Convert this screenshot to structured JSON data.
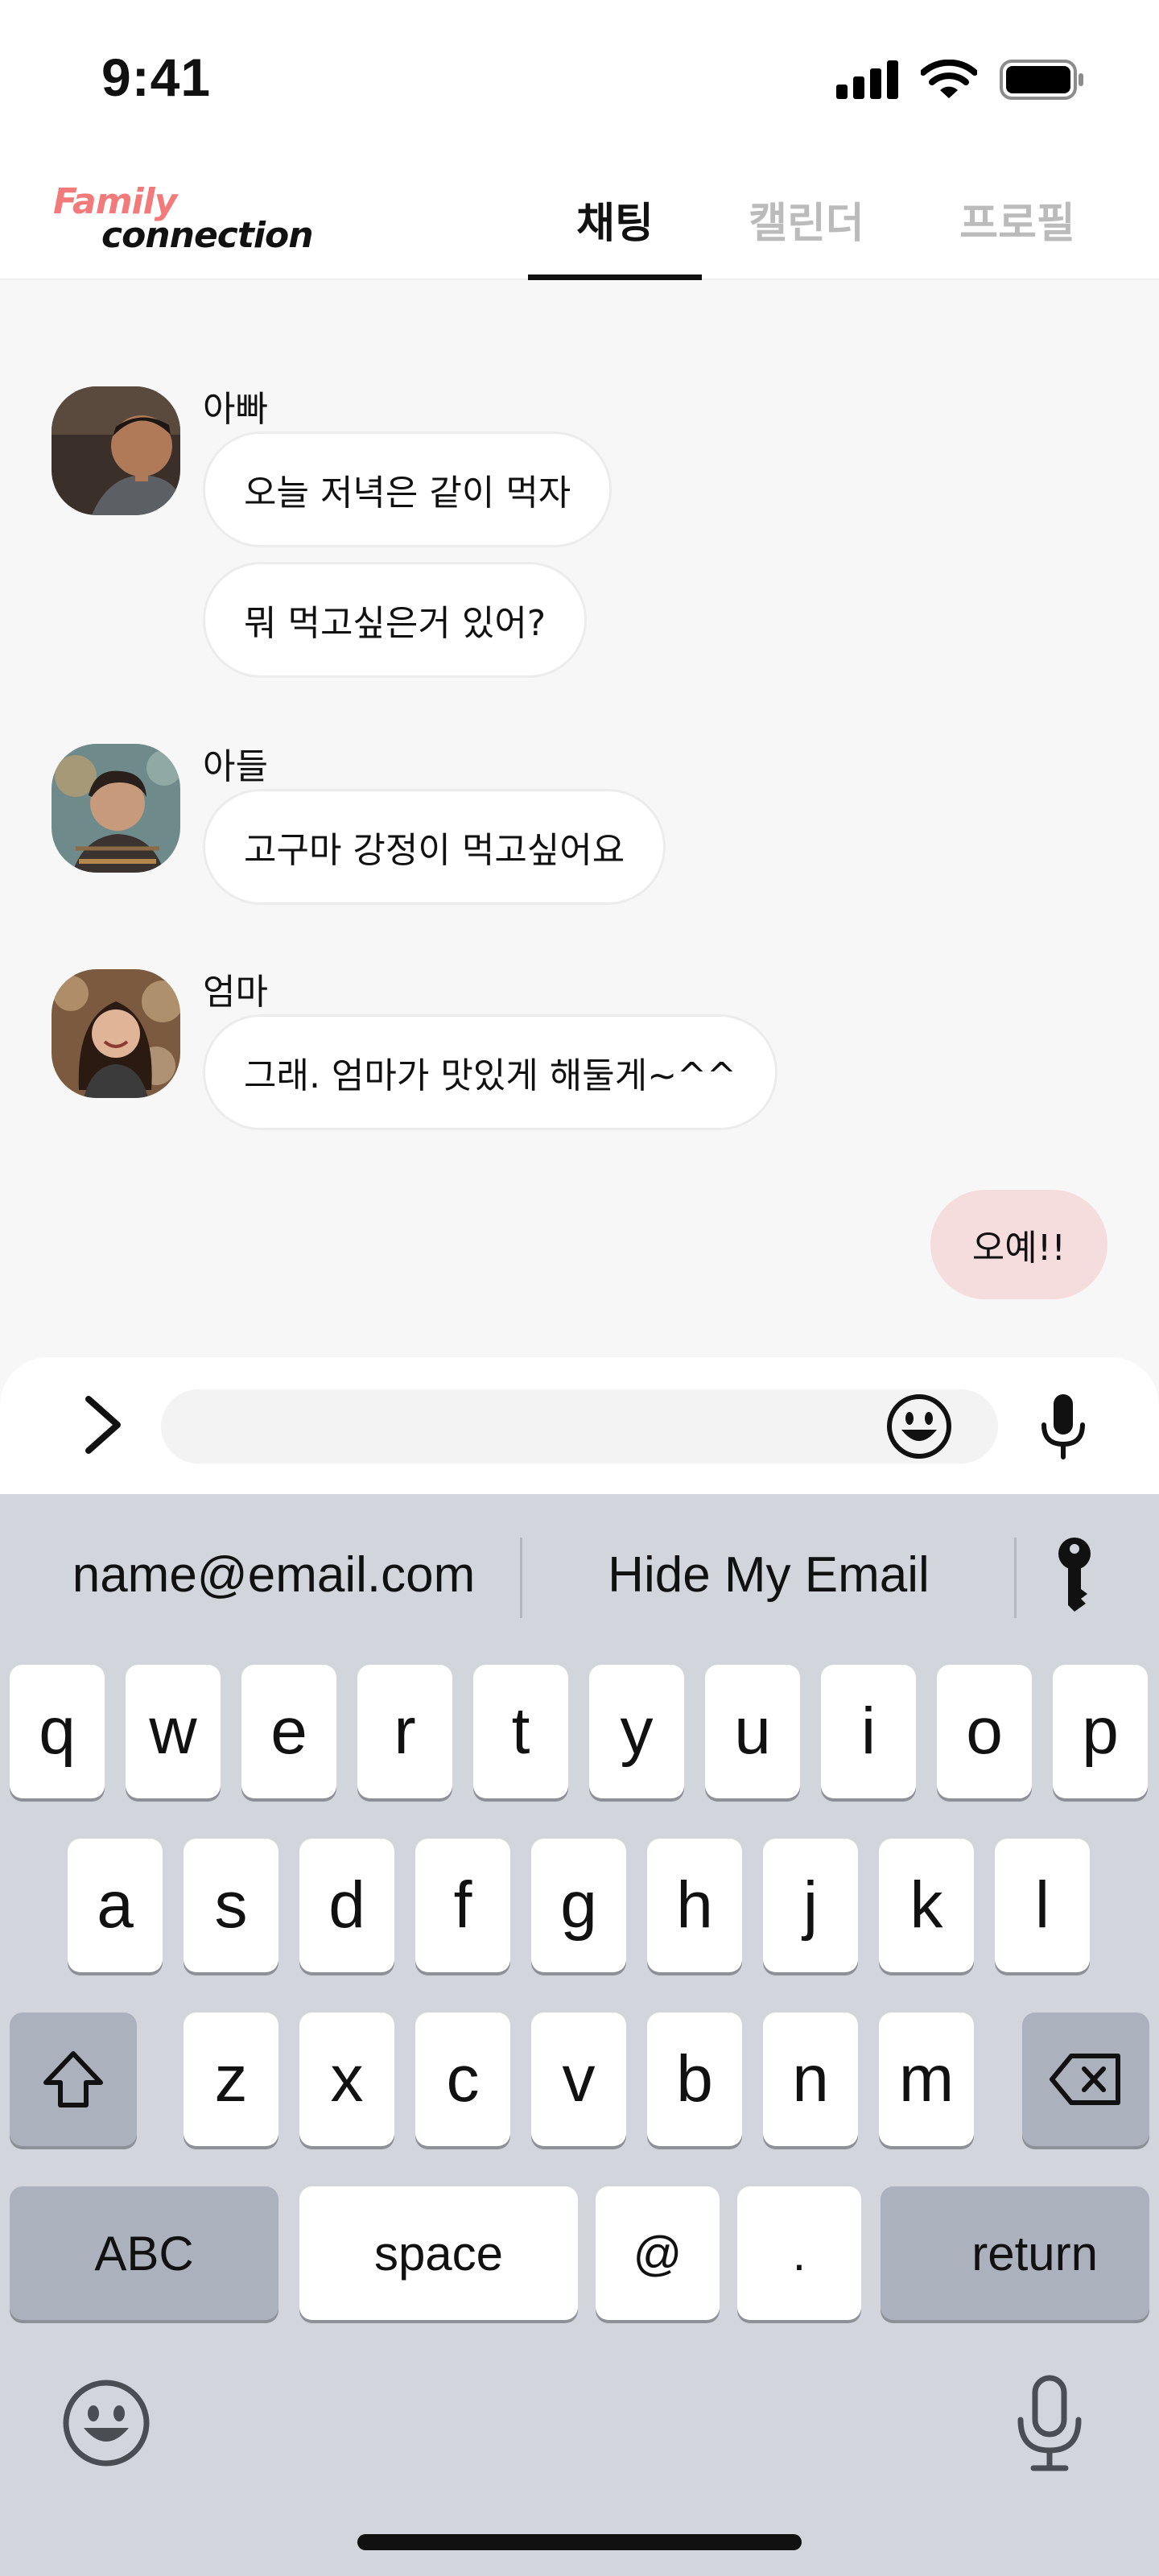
{
  "status_bar": {
    "time": "9:41",
    "icons": [
      "cellular-signal-icon",
      "wifi-icon",
      "battery-icon"
    ]
  },
  "header": {
    "logo": {
      "line1": "Family",
      "line2": "connection"
    },
    "tabs": [
      {
        "label": "채팅",
        "active": true
      },
      {
        "label": "캘린더",
        "active": false
      },
      {
        "label": "프로필",
        "active": false
      }
    ]
  },
  "colors": {
    "accent": "#f27a7a",
    "my_bubble": "#f6dddd",
    "keyboard_bg": "#d2d5dc"
  },
  "chat": {
    "groups": [
      {
        "sender": "아빠",
        "avatar": "dad-avatar",
        "messages": [
          "오늘 저녁은 같이 먹자",
          "뭐 먹고싶은거 있어?"
        ]
      },
      {
        "sender": "아들",
        "avatar": "son-avatar",
        "messages": [
          "고구마 강정이 먹고싶어요"
        ]
      },
      {
        "sender": "엄마",
        "avatar": "mom-avatar",
        "messages": [
          "그래. 엄마가 맛있게 해둘게~^^"
        ]
      }
    ],
    "my_message": "오예!!"
  },
  "composer": {
    "value": "",
    "icons": [
      "chevron-right-icon",
      "smiley-icon",
      "microphone-icon"
    ]
  },
  "keyboard": {
    "suggestions": [
      "name@email.com",
      "Hide My Email"
    ],
    "suggestion_icon": "key-icon",
    "row1": [
      "q",
      "w",
      "e",
      "r",
      "t",
      "y",
      "u",
      "i",
      "o",
      "p"
    ],
    "row2": [
      "a",
      "s",
      "d",
      "f",
      "g",
      "h",
      "j",
      "k",
      "l"
    ],
    "row3": [
      "z",
      "x",
      "c",
      "v",
      "b",
      "n",
      "m"
    ],
    "bottom": {
      "abc": "ABC",
      "space": "space",
      "at": "@",
      "dot": ".",
      "return": "return"
    },
    "icons": [
      "shift-icon",
      "backspace-icon",
      "emoji-icon",
      "dictation-icon"
    ]
  }
}
